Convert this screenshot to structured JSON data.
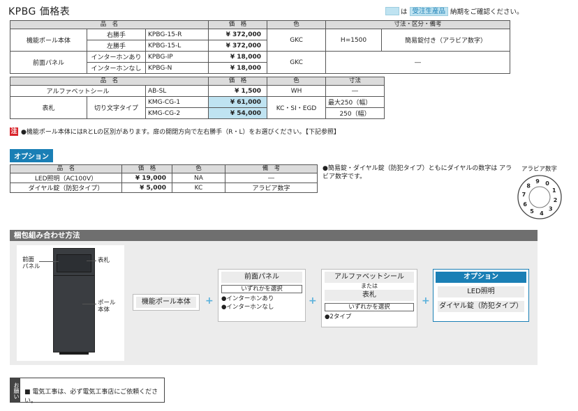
{
  "title": "KPBG 価格表",
  "legend": {
    "text_pre": "は",
    "tag": "受注生産品",
    "text_post": "納期をご確認ください。"
  },
  "table1": {
    "headers": [
      "品　名",
      "価　格",
      "色",
      "寸法・区分・備考"
    ],
    "rows": [
      {
        "group": "機能ポール本体",
        "sub": "右勝手",
        "code": "KPBG-15-R",
        "price": "¥ 372,000",
        "color": "GKC",
        "spec1": "H=1500",
        "spec2": "簡易錠付き（アラビア数字）"
      },
      {
        "sub": "左勝手",
        "code": "KPBG-15-L",
        "price": "¥ 372,000"
      },
      {
        "group": "前面パネル",
        "sub": "インターホンあり",
        "code": "KPBG-IP",
        "price": "¥  18,000",
        "color": "GKC",
        "spec": "―"
      },
      {
        "sub": "インターホンなし",
        "code": "KPBG-N",
        "price": "¥  18,000"
      }
    ]
  },
  "table2": {
    "headers": [
      "品　名",
      "価　格",
      "色",
      "寸法"
    ],
    "rows": [
      {
        "name": "アルファベットシール",
        "code": "AB-SL",
        "price": "¥    1,500",
        "color": "WH",
        "size": "―"
      },
      {
        "group": "表札",
        "sub": "切り文字タイプ",
        "code": "KMG-CG-1",
        "price": "¥  61,000",
        "color": "KC・SI・EGD",
        "size": "最大250（幅）"
      },
      {
        "code": "KMG-CG-2",
        "price": "¥  54,000",
        "size": "250（幅）"
      }
    ]
  },
  "note": {
    "mark": "注",
    "text": "●機能ポール本体にはRとLの区別があります。扉の開閉方向で左右勝手（R・L）をお選びください。【下記参照】"
  },
  "option": {
    "label": "オプション",
    "headers": [
      "品　名",
      "価　格",
      "色",
      "備　考"
    ],
    "rows": [
      {
        "name": "LED照明（AC100V）",
        "price": "¥ 19,000",
        "color": "NA",
        "note": "―"
      },
      {
        "name": "ダイヤル錠（防犯タイプ）",
        "price": "¥   5,000",
        "color": "KC",
        "note": "アラビア数字"
      }
    ],
    "side_note": "●簡易錠・ダイヤル錠（防犯タイプ）ともにダイヤルの数字は アラビア数字です。",
    "dial_label": "アラビア数字",
    "dial_digits": [
      "0",
      "1",
      "2",
      "3",
      "4",
      "5",
      "6",
      "7",
      "8",
      "9"
    ]
  },
  "packing": {
    "title": "梱包組み合わせ方法",
    "labels": {
      "front_panel": "前面\nパネル",
      "nameplate": "表札",
      "pole": "ポール\n本体"
    },
    "step1": "機能ポール本体",
    "step2": {
      "title": "前面パネル",
      "sub": "いずれかを選択",
      "items": [
        "●インターホンあり",
        "●インターホンなし"
      ]
    },
    "step3": {
      "title": "アルファベットシール",
      "or": "または",
      "title2": "表札",
      "sub": "いずれかを選択",
      "items": [
        "●2タイプ"
      ]
    },
    "step4": {
      "title": "オプション",
      "items": [
        "LED照明",
        "ダイヤル錠（防犯タイプ）"
      ]
    },
    "plus": "+"
  },
  "request": {
    "tab": "お願い",
    "text": "■ 電気工事は、必ず電気工事店にご依頼ください。"
  },
  "colors": {
    "accent": "#1a7fb5",
    "highlight": "#bfe3f1",
    "note_red": "#d9232a",
    "pole": "#3a3d41"
  }
}
